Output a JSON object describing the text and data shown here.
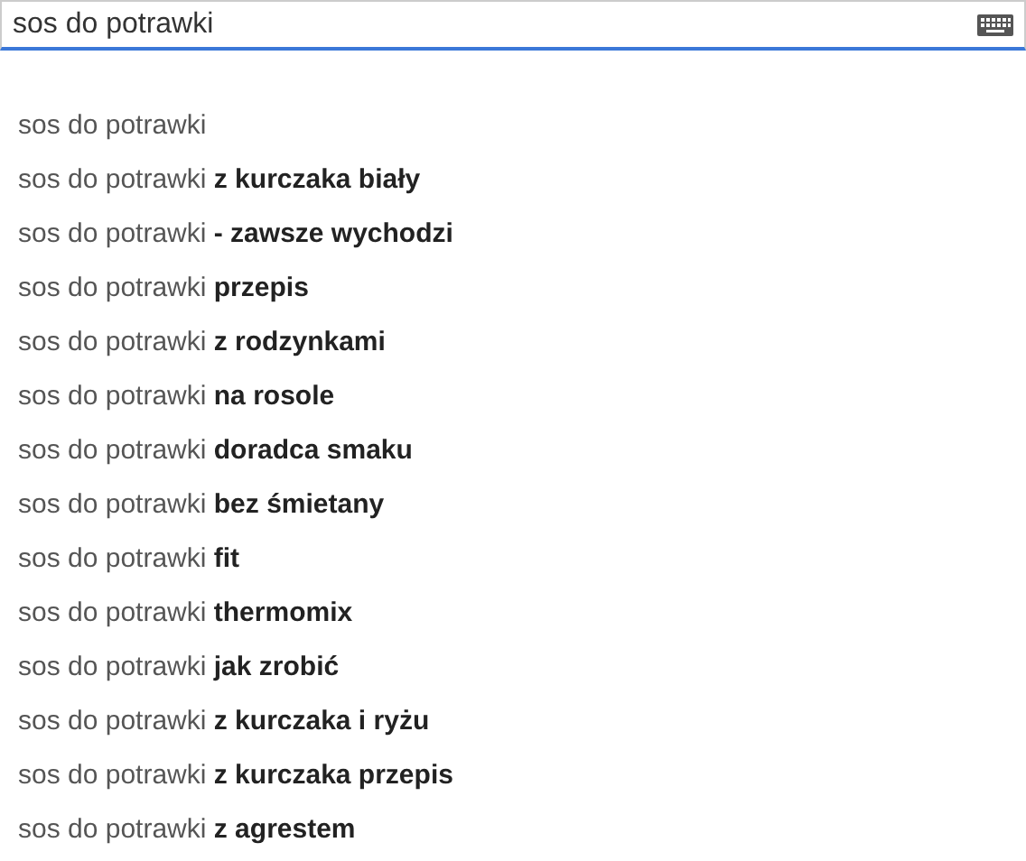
{
  "search": {
    "value": "sos do potrawki"
  },
  "suggestions": [
    "sos do potrawki",
    "sos do potrawki **z kurczaka biały**",
    "sos do potrawki **- zawsze wychodzi**",
    "sos do potrawki **przepis**",
    "sos do potrawki **z rodzynkami**",
    "sos do potrawki **na rosole**",
    "sos do potrawki **doradca smaku**",
    "sos do potrawki **bez śmietany**",
    "sos do potrawki **fit**",
    "sos do potrawki **thermomix**",
    "sos do potrawki **jak zrobić**",
    "sos do potrawki **z kurczaka i ryżu**",
    "sos do potrawki **z kurczaka przepis**",
    "sos do potrawki **z agrestem**"
  ]
}
